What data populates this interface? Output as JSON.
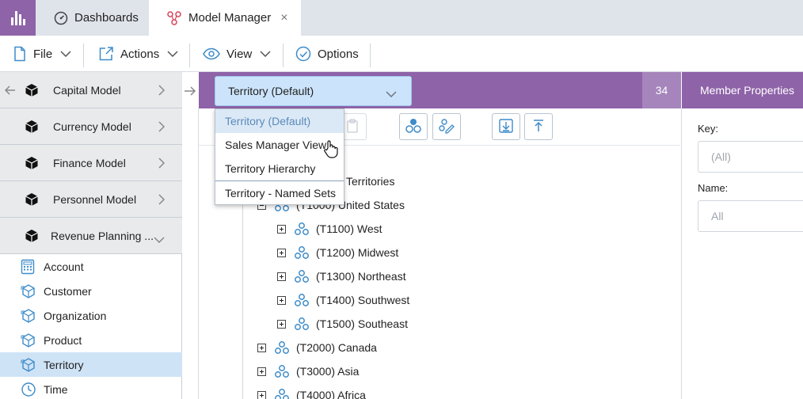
{
  "tabs": [
    {
      "label": "Dashboards",
      "icon": "gauge-icon"
    },
    {
      "label": "Model Manager",
      "icon": "model-icon",
      "close": "×"
    }
  ],
  "menu": {
    "file": "File",
    "actions": "Actions",
    "view": "View",
    "options": "Options"
  },
  "models": [
    {
      "label": "Capital Model"
    },
    {
      "label": "Currency Model"
    },
    {
      "label": "Finance Model"
    },
    {
      "label": "Personnel Model"
    },
    {
      "label": "Revenue Planning ..."
    }
  ],
  "dimensions": [
    {
      "label": "Account",
      "icon": "calculator-icon"
    },
    {
      "label": "Customer",
      "icon": "dimension-cube-icon"
    },
    {
      "label": "Organization",
      "icon": "dimension-cube-icon"
    },
    {
      "label": "Product",
      "icon": "dimension-cube-icon"
    },
    {
      "label": "Territory",
      "icon": "dimension-cube-icon",
      "active": true
    },
    {
      "label": "Time",
      "icon": "clock-icon"
    }
  ],
  "hierarchy_select": {
    "value": "Territory (Default)"
  },
  "member_count": "34",
  "dropdown": {
    "items": [
      "Territory (Default)",
      "Sales Manager View",
      "Territory Hierarchy",
      "Territory - Named Sets"
    ]
  },
  "tree": {
    "root_partial": "Territories",
    "rows": [
      "(T1000) United States",
      "(T1100) West",
      "(T1200) Midwest",
      "(T1300) Northeast",
      "(T1400) Southwest",
      "(T1500) Southeast",
      "(T2000) Canada",
      "(T3000) Asia",
      "(T4000) Africa"
    ]
  },
  "properties": {
    "title": "Member Properties",
    "key_label": "Key:",
    "key_value": "(All)",
    "name_label": "Name:",
    "name_value": "All"
  },
  "colors": {
    "accent_purple": "#8e63a8",
    "selection_blue": "#cfe3f7",
    "icon_blue": "#3d8bc9"
  }
}
